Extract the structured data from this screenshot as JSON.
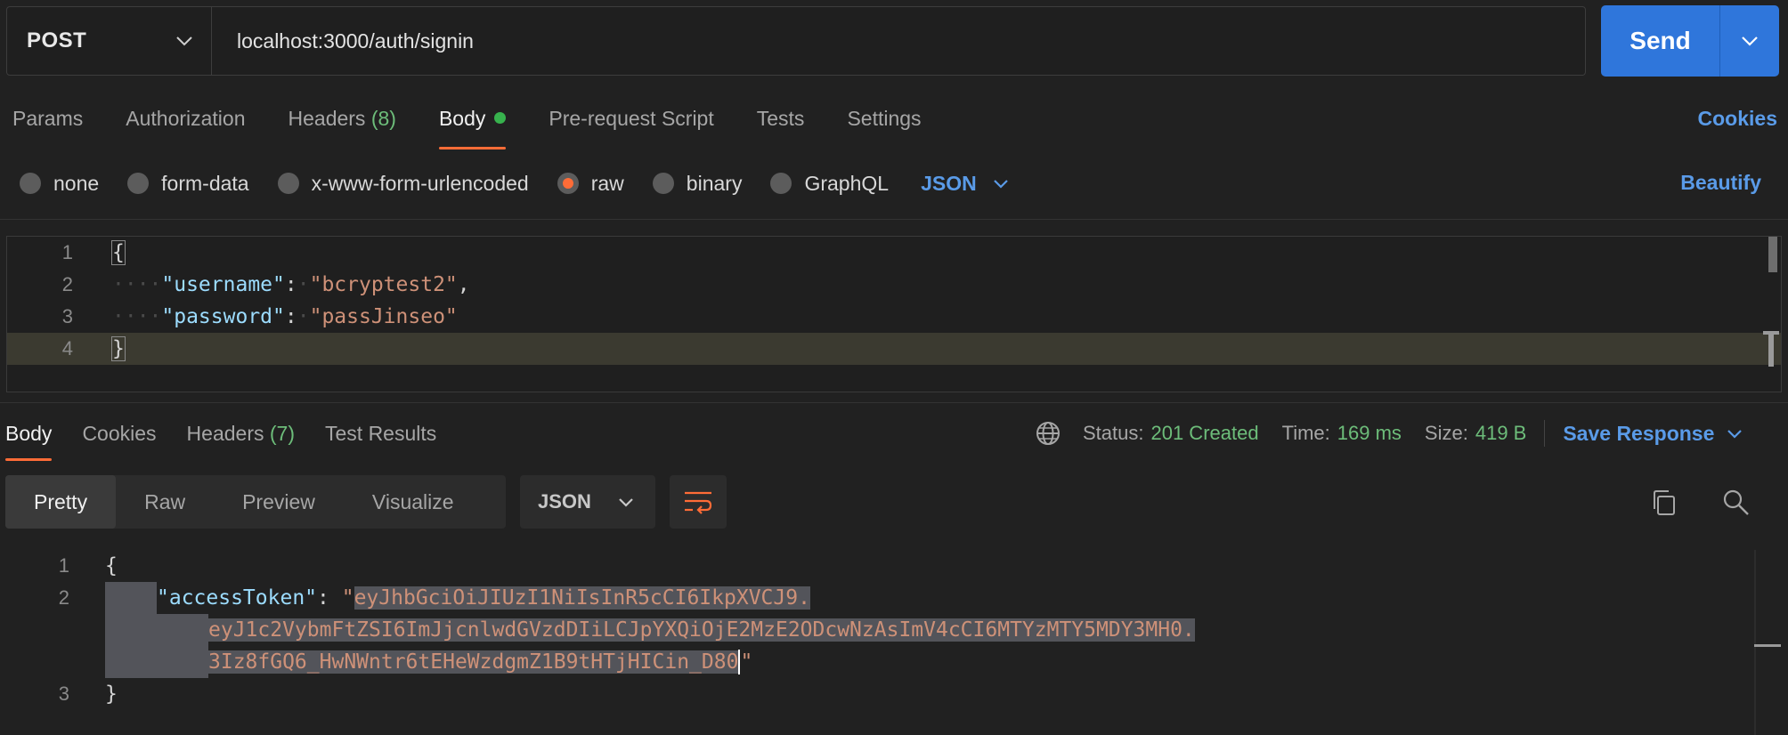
{
  "request": {
    "method": "POST",
    "url": "localhost:3000/auth/signin",
    "send_label": "Send"
  },
  "request_tabs": [
    {
      "label": "Params",
      "count": "",
      "active": false
    },
    {
      "label": "Authorization",
      "count": "",
      "active": false
    },
    {
      "label": "Headers",
      "count": "(8)",
      "active": false
    },
    {
      "label": "Body",
      "count": "",
      "active": true,
      "dot": true
    },
    {
      "label": "Pre-request Script",
      "count": "",
      "active": false
    },
    {
      "label": "Tests",
      "count": "",
      "active": false
    },
    {
      "label": "Settings",
      "count": "",
      "active": false
    }
  ],
  "cookies_link": "Cookies",
  "body_types": [
    {
      "label": "none",
      "selected": false
    },
    {
      "label": "form-data",
      "selected": false
    },
    {
      "label": "x-www-form-urlencoded",
      "selected": false
    },
    {
      "label": "raw",
      "selected": true
    },
    {
      "label": "binary",
      "selected": false
    },
    {
      "label": "GraphQL",
      "selected": false
    }
  ],
  "raw_format": "JSON",
  "beautify_label": "Beautify",
  "request_body": {
    "line_numbers": [
      "1",
      "2",
      "3",
      "4"
    ],
    "open_brace": "{",
    "close_brace": "}",
    "fields": [
      {
        "key": "\"username\"",
        "value": "\"bcryptest2\"",
        "trail": ","
      },
      {
        "key": "\"password\"",
        "value": "\"passJinseo\"",
        "trail": ""
      }
    ]
  },
  "response_tabs": [
    {
      "label": "Body",
      "count": "",
      "active": true
    },
    {
      "label": "Cookies",
      "count": "",
      "active": false
    },
    {
      "label": "Headers",
      "count": "(7)",
      "active": false
    },
    {
      "label": "Test Results",
      "count": "",
      "active": false
    }
  ],
  "response_status": {
    "status_label": "Status:",
    "status_value": "201 Created",
    "time_label": "Time:",
    "time_value": "169 ms",
    "size_label": "Size:",
    "size_value": "419 B",
    "save_label": "Save Response"
  },
  "response_views": [
    {
      "label": "Pretty",
      "active": true
    },
    {
      "label": "Raw",
      "active": false
    },
    {
      "label": "Preview",
      "active": false
    },
    {
      "label": "Visualize",
      "active": false
    }
  ],
  "response_format": "JSON",
  "response_body": {
    "line_numbers": [
      "1",
      "2",
      "3"
    ],
    "open_brace": "{",
    "close_brace": "}",
    "key": "\"accessToken\"",
    "colon": ": ",
    "quote_open": "\"",
    "token_part1": "eyJhbGciOiJIUzI1NiIsInR5cCI6IkpXVCJ9.",
    "token_part2": "eyJ1c2VybmFtZSI6ImJjcnlwdGVzdDIiLCJpYXQiOjE2MzE2ODcwNzAsImV4cCI6MTYzMTY5MDY3MH0.",
    "token_part3": "3Iz8fGQ6_HwNWntr6tEHeWzdgmZ1B9tHTjHICin_D80",
    "quote_close": "\""
  },
  "colors": {
    "accent_orange": "#ff6c37",
    "link_blue": "#5a9be8",
    "send_blue": "#2f76db",
    "status_green": "#6dbd7a",
    "json_key": "#9cdcfe",
    "json_string": "#ce9178"
  }
}
